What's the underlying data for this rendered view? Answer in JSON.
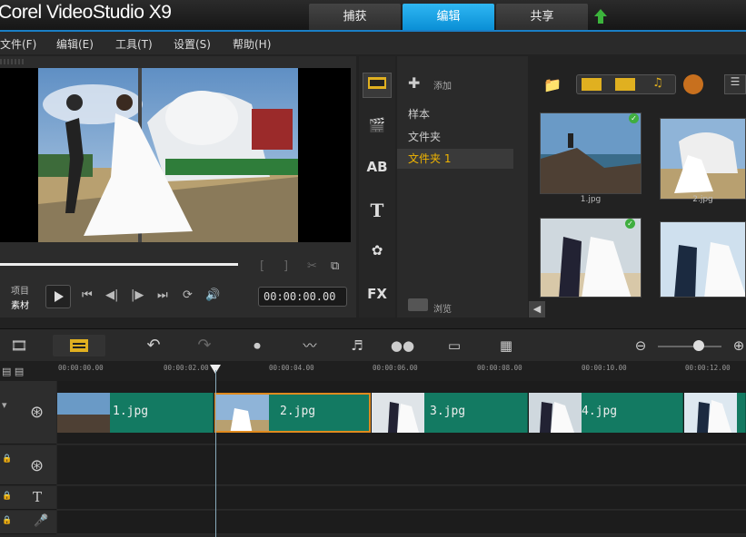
{
  "app": {
    "title": "Corel VideoStudio X9"
  },
  "top_tabs": [
    {
      "label": "捕获"
    },
    {
      "label": "编辑"
    },
    {
      "label": "共享"
    }
  ],
  "menu": [
    {
      "label": "文件(F)"
    },
    {
      "label": "编辑(E)"
    },
    {
      "label": "工具(T)"
    },
    {
      "label": "设置(S)"
    },
    {
      "label": "帮助(H)"
    }
  ],
  "preview": {
    "mode_project": "项目",
    "mode_clip": "素材",
    "timecode": "00:00:00.00"
  },
  "library": {
    "add_label": "添加",
    "browse_label": "浏览",
    "categories": [
      {
        "label": "样本"
      },
      {
        "label": "文件夹"
      },
      {
        "label": "文件夹 1"
      }
    ],
    "thumbnails": [
      {
        "name": "1.jpg"
      },
      {
        "name": "2.jpg"
      },
      {
        "name": ""
      },
      {
        "name": ""
      }
    ],
    "side_labels": [
      "AB",
      "T",
      "FX"
    ]
  },
  "ruler": {
    "ticks": [
      "00:00:00.00",
      "00:00:02.00",
      "00:00:04.00",
      "00:00:06.00",
      "00:00:08.00",
      "00:00:10.00",
      "00:00:12.00"
    ]
  },
  "timeline": {
    "clips": [
      {
        "label": "1.jpg"
      },
      {
        "label": "2.jpg"
      },
      {
        "label": "3.jpg"
      },
      {
        "label": "4.jpg"
      }
    ]
  },
  "colors": {
    "accent": "#0a8fd6",
    "clip": "#137a62",
    "selected_clip_border": "#e08a1e",
    "selected_folder": "#f0b400"
  }
}
